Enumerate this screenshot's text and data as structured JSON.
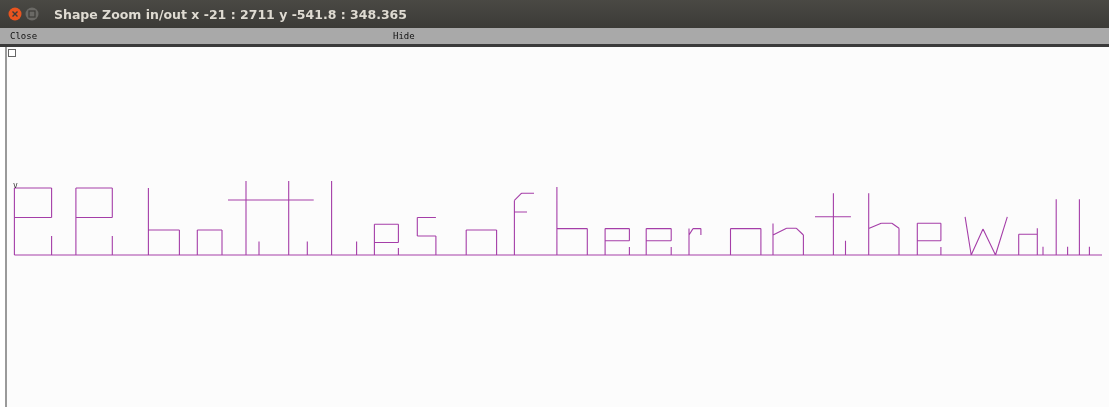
{
  "window": {
    "title": "Shape Zoom in/out x -21 : 2711  y -541.8 : 348.365"
  },
  "menu": [
    {
      "label": "Close"
    },
    {
      "label": "Hide"
    }
  ],
  "canvas": {
    "checkbox": {
      "checked": false
    },
    "marker": "v"
  }
}
